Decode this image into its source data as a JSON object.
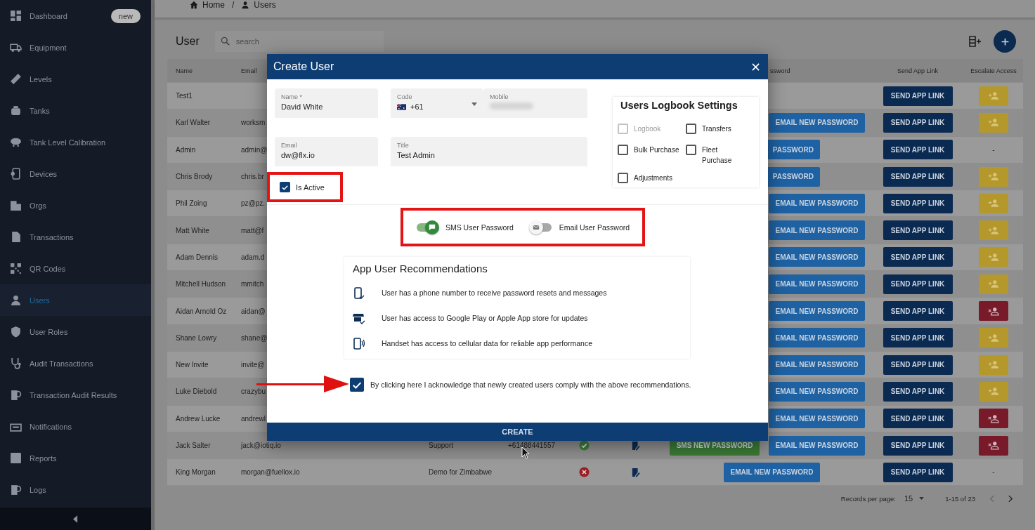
{
  "breadcrumb": {
    "items": [
      "Home",
      "Users"
    ],
    "separator": "/"
  },
  "sidebar": {
    "items": [
      {
        "label": "Dashboard",
        "badge": "new",
        "selected": false
      },
      {
        "label": "Equipment",
        "selected": false
      },
      {
        "label": "Levels",
        "selected": false
      },
      {
        "label": "Tanks",
        "selected": false
      },
      {
        "label": "Tank Level Calibration",
        "selected": false
      },
      {
        "label": "Devices",
        "selected": false
      },
      {
        "label": "Orgs",
        "selected": false
      },
      {
        "label": "Transactions",
        "selected": false
      },
      {
        "label": "QR Codes",
        "selected": false
      },
      {
        "label": "Users",
        "selected": true
      },
      {
        "label": "User Roles",
        "selected": false
      },
      {
        "label": "Audit Transactions",
        "selected": false
      },
      {
        "label": "Transaction Audit Results",
        "selected": false
      },
      {
        "label": "Notifications",
        "selected": false
      },
      {
        "label": "Reports",
        "selected": false
      },
      {
        "label": "Logs",
        "selected": false
      }
    ]
  },
  "page": {
    "title": "User",
    "search": {
      "placeholder": "search"
    }
  },
  "table": {
    "header": {
      "name": "Name",
      "email": "Email",
      "password": "ssword",
      "send_link": "Send App Link",
      "escalate": "Escalate Access"
    },
    "rows": [
      {
        "name": "Test1",
        "send_link": "SEND APP LINK",
        "escalate": {
          "kind": "grant"
        }
      },
      {
        "name": "Karl Walter",
        "email": "worksm",
        "password_buttons": [
          {
            "kind": "email",
            "label": "EMAIL NEW PASSWORD"
          }
        ],
        "send_link": "SEND APP LINK",
        "escalate": {
          "kind": "grant"
        }
      },
      {
        "name": "Admin",
        "email": "admin@",
        "password_buttons": [
          {
            "kind": "email_cut",
            "label": "PASSWORD"
          }
        ],
        "send_link": "SEND APP LINK",
        "escalate": {
          "kind": "none",
          "text": "-"
        }
      },
      {
        "name": "Chris Brody",
        "email": "chris.br",
        "password_buttons": [
          {
            "kind": "email_cut",
            "label": "PASSWORD"
          }
        ],
        "send_link": "SEND APP LINK",
        "escalate": {
          "kind": "grant"
        }
      },
      {
        "name": "Phil Zoing",
        "email": "pz@pz.",
        "password_buttons": [
          {
            "kind": "email",
            "label": "EMAIL NEW PASSWORD"
          }
        ],
        "send_link": "SEND APP LINK",
        "escalate": {
          "kind": "grant"
        }
      },
      {
        "name": "Matt White",
        "email": "matt@f",
        "password_buttons": [
          {
            "kind": "email",
            "label": "EMAIL NEW PASSWORD"
          }
        ],
        "send_link": "SEND APP LINK",
        "escalate": {
          "kind": "grant"
        }
      },
      {
        "name": "Adam Dennis",
        "email": "adam.d",
        "password_buttons": [
          {
            "kind": "email",
            "label": "EMAIL NEW PASSWORD"
          }
        ],
        "send_link": "SEND APP LINK",
        "escalate": {
          "kind": "grant"
        }
      },
      {
        "name": "Mitchell Hudson",
        "email": "mmitch",
        "password_buttons": [
          {
            "kind": "email",
            "label": "EMAIL NEW PASSWORD"
          }
        ],
        "send_link": "SEND APP LINK",
        "escalate": {
          "kind": "grant"
        }
      },
      {
        "name": "Aidan Arnold Oz",
        "email": "aidan@",
        "password_buttons": [
          {
            "kind": "email",
            "label": "EMAIL NEW PASSWORD"
          }
        ],
        "send_link": "SEND APP LINK",
        "escalate": {
          "kind": "revoke"
        }
      },
      {
        "name": "Shane Lowry",
        "email": "shane@",
        "password_buttons": [
          {
            "kind": "email",
            "label": "EMAIL NEW PASSWORD"
          }
        ],
        "send_link": "SEND APP LINK",
        "escalate": {
          "kind": "grant"
        }
      },
      {
        "name": "New Invite",
        "email": "invite@",
        "password_buttons": [
          {
            "kind": "email",
            "label": "EMAIL NEW PASSWORD"
          }
        ],
        "send_link": "SEND APP LINK",
        "escalate": {
          "kind": "grant"
        }
      },
      {
        "name": "Luke Diebold",
        "email": "crazybu",
        "password_buttons": [
          {
            "kind": "email",
            "label": "EMAIL NEW PASSWORD"
          }
        ],
        "send_link": "SEND APP LINK",
        "escalate": {
          "kind": "grant"
        }
      },
      {
        "name": "Andrew Lucke",
        "email": "andrewl",
        "password_buttons": [
          {
            "kind": "email",
            "label": "EMAIL NEW PASSWORD"
          }
        ],
        "send_link": "SEND APP LINK",
        "escalate": {
          "kind": "revoke"
        }
      },
      {
        "name": "Jack Salter",
        "email": "jack@iotiq.io",
        "title": "Support",
        "mobile": "+61488441557",
        "active": true,
        "logbook": true,
        "password_buttons": [
          {
            "kind": "sms",
            "label": "SMS NEW PASSWORD"
          },
          {
            "kind": "email",
            "label": "EMAIL NEW PASSWORD"
          }
        ],
        "send_link": "SEND APP LINK",
        "escalate": {
          "kind": "revoke"
        }
      },
      {
        "name": "King Morgan",
        "email": "morgan@fuellox.io",
        "title": "Demo for Zimbabwe",
        "active": false,
        "logbook": true,
        "password_buttons": [
          {
            "kind": "email_single",
            "label": "EMAIL NEW PASSWORD"
          }
        ],
        "send_link": "SEND APP LINK",
        "escalate": {
          "kind": "none",
          "text": "-"
        }
      }
    ]
  },
  "pagination": {
    "label": "Records per page:",
    "per_page": "15",
    "range": "1-15 of 23",
    "prev_disabled": true
  },
  "dialog": {
    "title": "Create User",
    "fields": [
      {
        "kind": "text",
        "label": "Name *",
        "value": "David White"
      },
      {
        "kind": "code",
        "label": "Code",
        "value": "+61"
      },
      {
        "kind": "blurred",
        "label": "Mobile"
      },
      {
        "kind": "text",
        "label": "Email",
        "value": "dw@flx.io"
      },
      {
        "kind": "text",
        "label": "Title",
        "value": "Test Admin"
      }
    ],
    "is_active": {
      "label": "Is Active",
      "checked": true,
      "highlighted": true
    },
    "logbook": {
      "title": "Users Logbook Settings",
      "options": [
        {
          "label": "Logbook",
          "checked": false,
          "disabled": true
        },
        {
          "label": "Transfers",
          "checked": false,
          "disabled": false
        },
        {
          "label": "Bulk Purchase",
          "checked": false,
          "disabled": false
        },
        {
          "label": "Fleet Purchase",
          "checked": false,
          "disabled": false
        },
        {
          "label": "Adjustments",
          "checked": false,
          "disabled": false
        }
      ]
    },
    "password_toggles": {
      "highlighted": true,
      "items": [
        {
          "label": "SMS User Password",
          "on": true
        },
        {
          "label": "Email User Password",
          "on": false
        }
      ]
    },
    "recommendations": {
      "title": "App User Recommendations",
      "items": [
        "User has a phone number to receive password resets and messages",
        "User has access to Google Play or Apple App store for updates",
        "Handset has access to cellular data for reliable app performance"
      ]
    },
    "acknowledge": {
      "label": "By clicking here I acknowledge that newly created users comply with the above recommendations.",
      "checked": true,
      "pointer_arrow": true
    },
    "create_button": "CREATE"
  }
}
